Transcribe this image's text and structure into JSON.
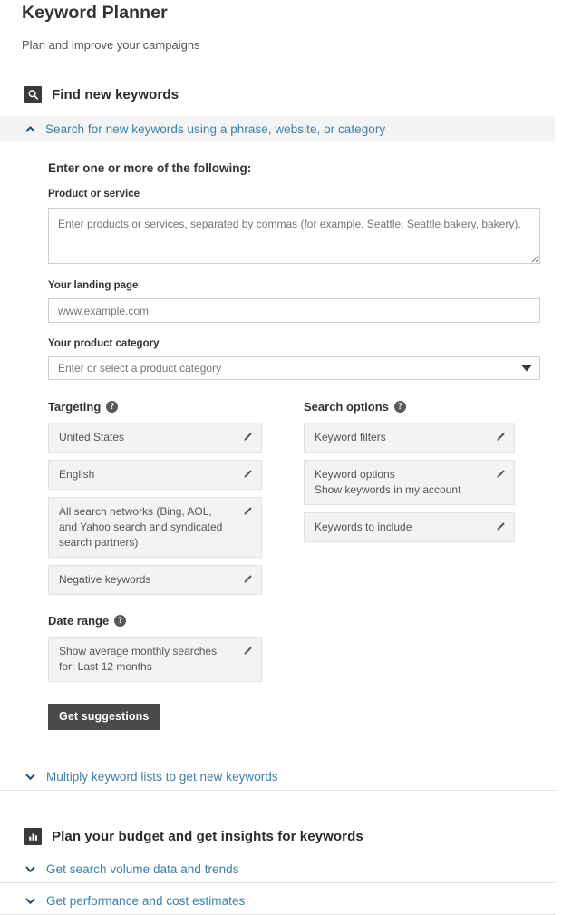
{
  "header": {
    "title": "Keyword Planner",
    "subtitle": "Plan and improve your campaigns"
  },
  "find_keywords": {
    "icon": "search-icon",
    "heading": "Find new keywords",
    "accordion": {
      "label": "Search for new keywords using a phrase, website, or category",
      "chevron": "chevron-up-icon",
      "expanded": true
    },
    "lead": "Enter one or more of the following:",
    "fields": [
      {
        "label": "Product or service",
        "placeholder": "Enter products or services, separated by commas (for example, Seattle, Seattle bakery, bakery).",
        "value": "",
        "type": "textarea"
      },
      {
        "label": "Your landing page",
        "placeholder": "www.example.com",
        "value": "",
        "type": "text"
      },
      {
        "label": "Your product category",
        "placeholder": "Enter or select a product category",
        "value": "",
        "type": "select"
      }
    ],
    "targeting": {
      "title": "Targeting",
      "help": "?",
      "options": [
        {
          "lines": [
            "United States"
          ],
          "edit": "pencil-icon"
        },
        {
          "lines": [
            "English"
          ],
          "edit": "pencil-icon"
        },
        {
          "lines": [
            "All search networks (Bing, AOL,",
            "and Yahoo search and syndicated",
            "search partners)"
          ],
          "edit": "pencil-icon"
        },
        {
          "lines": [
            "Negative keywords"
          ],
          "edit": "pencil-icon"
        }
      ]
    },
    "search_options": {
      "title": "Search options",
      "help": "?",
      "options": [
        {
          "lines": [
            "Keyword filters"
          ],
          "edit": "pencil-icon"
        },
        {
          "lines": [
            "Keyword options",
            "Show keywords in my account"
          ],
          "edit": "pencil-icon"
        },
        {
          "lines": [
            "Keywords to include"
          ],
          "edit": "pencil-icon"
        }
      ]
    },
    "date_range": {
      "title": "Date range",
      "help": "?",
      "options": [
        {
          "lines": [
            "Show average monthly searches",
            "for: Last 12 months"
          ],
          "edit": "pencil-icon"
        }
      ]
    },
    "submit_button": "Get suggestions",
    "multiply_row": {
      "label": "Multiply keyword lists to get new keywords",
      "chevron": "chevron-down-icon"
    }
  },
  "plan_budget": {
    "icon": "bar-chart-icon",
    "heading": "Plan your budget and get insights for keywords",
    "rows": [
      {
        "label": "Get search volume data and trends",
        "chevron": "chevron-down-icon"
      },
      {
        "label": "Get performance and cost estimates",
        "chevron": "chevron-down-icon"
      }
    ]
  },
  "colors": {
    "link": "#3f7fa8",
    "chevron": "#1f4e79",
    "icon_square": "#3a3a3a",
    "button": "#4a4a4a",
    "bar_bg": "#f4f4f4",
    "option_bg": "#f3f3f3"
  }
}
